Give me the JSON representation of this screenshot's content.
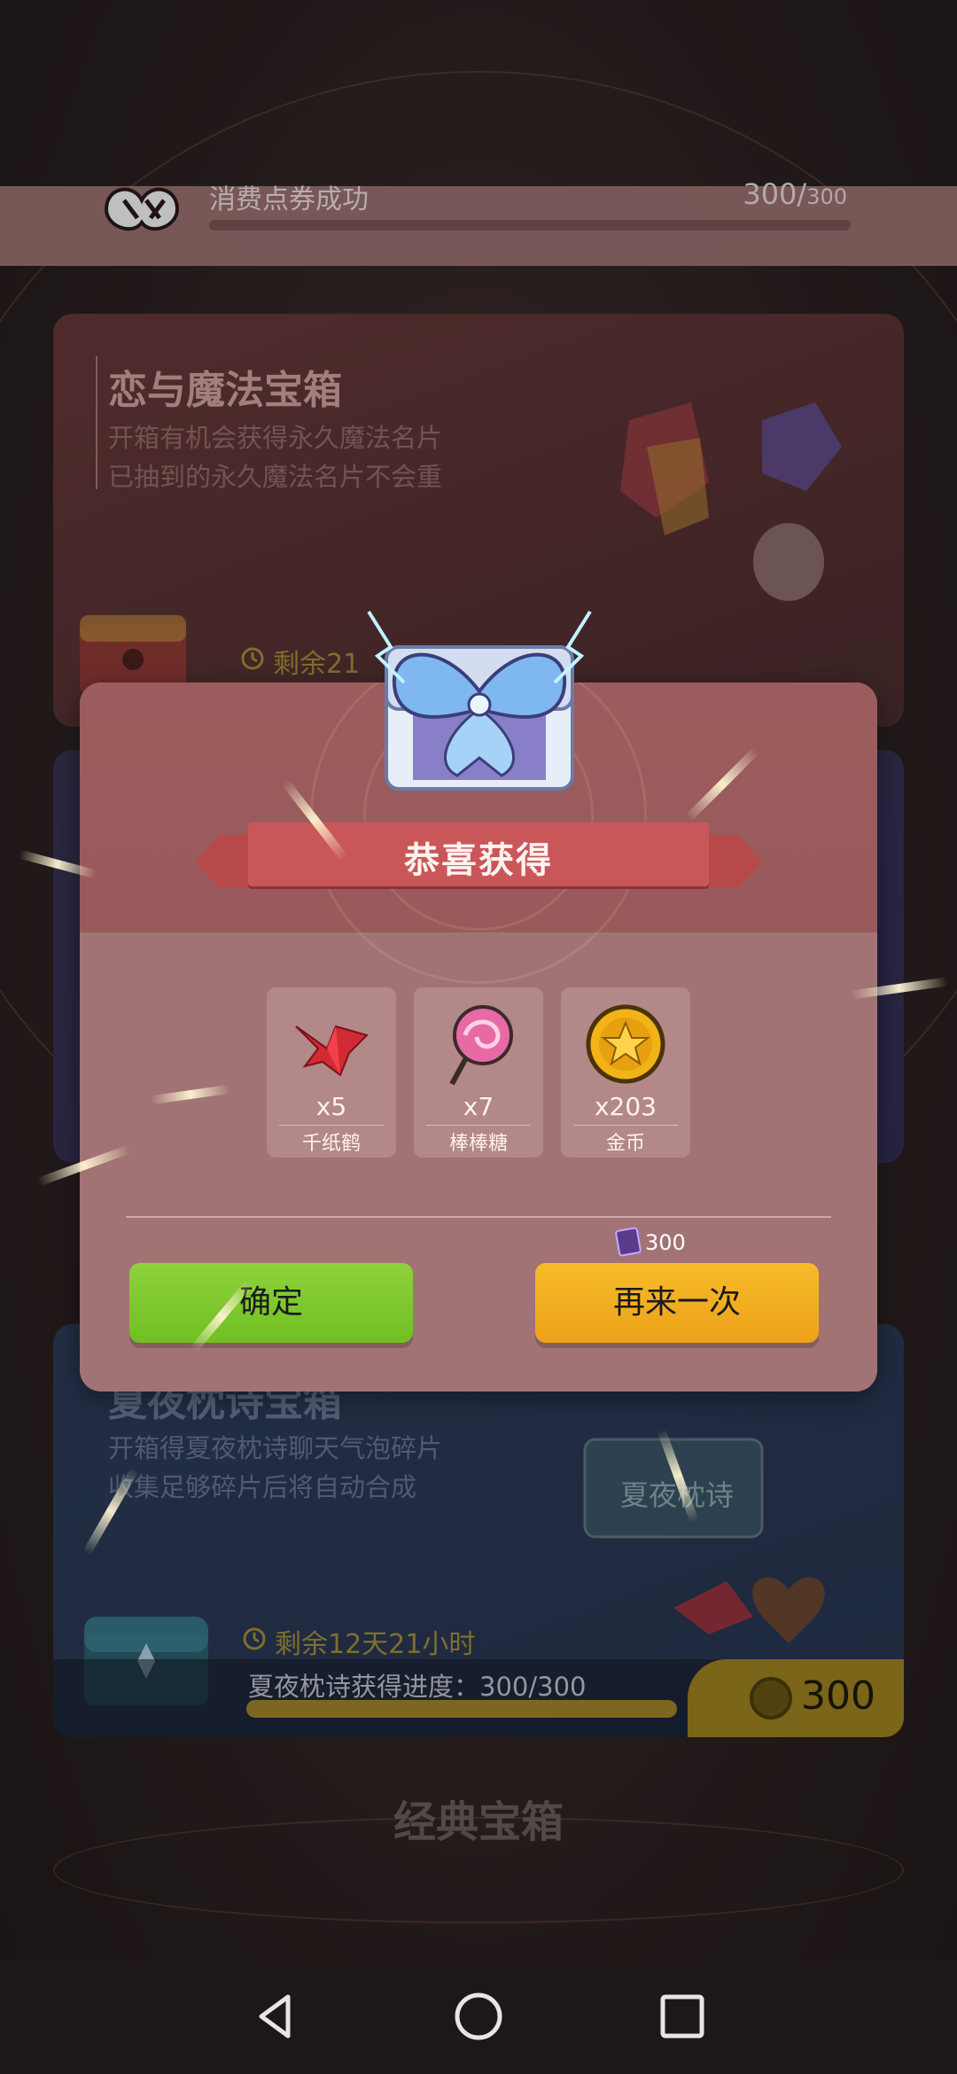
{
  "toast": {
    "message": "消费点券成功",
    "count": "300/",
    "total": "300"
  },
  "cards": [
    {
      "title": "恋与魔法宝箱",
      "desc_line1": "开箱有机会获得永久魔法名片",
      "desc_line2": "已抽到的永久魔法名片不会重",
      "timer": "剩余21"
    },
    {
      "title": "夏夜枕诗宝箱",
      "desc_line1": "开箱得夏夜枕诗聊天气泡碎片",
      "desc_line2": "收集足够碎片后将自动合成",
      "timer": "剩余12天21小时",
      "progress": "夏夜枕诗获得进度：300/300",
      "progress_fraction": 1.0,
      "price": "300",
      "badge_text": "夏夜枕诗"
    }
  ],
  "section_title": "经典宝箱",
  "modal": {
    "title": "恭喜获得",
    "items": [
      {
        "qty": "x5",
        "name": "千纸鹤",
        "icon": "paper-crane-icon"
      },
      {
        "qty": "x7",
        "name": "棒棒糖",
        "icon": "lollipop-icon"
      },
      {
        "qty": "x203",
        "name": "金币",
        "icon": "gold-coin-icon"
      }
    ],
    "cost": "300",
    "confirm_label": "确定",
    "again_label": "再来一次"
  },
  "colors": {
    "confirm": "#7fc82e",
    "again": "#f0ad1f",
    "banner": "#c95759",
    "modal": "#a27374"
  }
}
